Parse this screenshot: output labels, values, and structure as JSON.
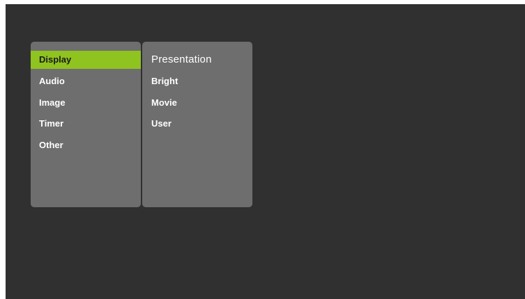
{
  "colors": {
    "background": "#303030",
    "panel": "#6e6e6e",
    "selected": "#8fc31f",
    "text": "#ffffff"
  },
  "menu": {
    "items": [
      {
        "label": "Display",
        "selected": true
      },
      {
        "label": "Audio",
        "selected": false
      },
      {
        "label": "Image",
        "selected": false
      },
      {
        "label": "Timer",
        "selected": false
      },
      {
        "label": "Other",
        "selected": false
      }
    ]
  },
  "submenu": {
    "title": "Presentation",
    "items": [
      {
        "label": "Bright"
      },
      {
        "label": "Movie"
      },
      {
        "label": "User"
      }
    ]
  }
}
